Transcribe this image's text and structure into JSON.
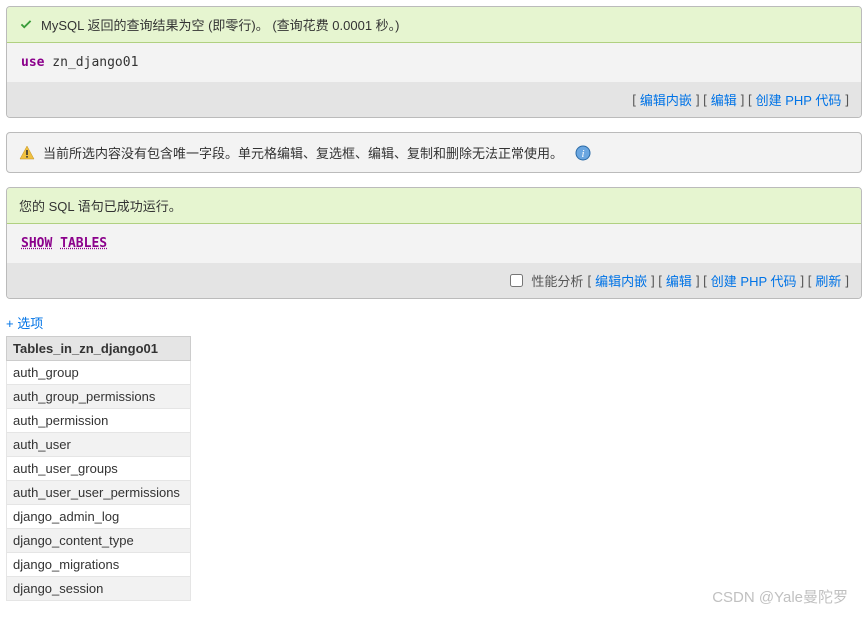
{
  "panel1": {
    "success_msg": "MySQL 返回的查询结果为空 (即零行)。 (查询花费 0.0001 秒。)",
    "sql_keyword": "use",
    "sql_rest": " zn_django01",
    "actions": {
      "edit_inline": "编辑内嵌",
      "edit": "编辑",
      "create_php": "创建 PHP 代码"
    }
  },
  "warning": {
    "text": "当前所选内容没有包含唯一字段。单元格编辑、复选框、编辑、复制和删除无法正常使用。"
  },
  "panel2": {
    "success_msg": "您的 SQL 语句已成功运行。",
    "sql_kw1": "SHOW",
    "sql_kw2": "TABLES",
    "perf_label": "性能分析",
    "actions": {
      "edit_inline": "编辑内嵌",
      "edit": "编辑",
      "create_php": "创建 PHP 代码",
      "refresh": "刷新"
    }
  },
  "options_link": "+ 选项",
  "table": {
    "header": "Tables_in_zn_django01",
    "rows": [
      "auth_group",
      "auth_group_permissions",
      "auth_permission",
      "auth_user",
      "auth_user_groups",
      "auth_user_user_permissions",
      "django_admin_log",
      "django_content_type",
      "django_migrations",
      "django_session"
    ]
  },
  "watermark": "CSDN @Yale曼陀罗"
}
